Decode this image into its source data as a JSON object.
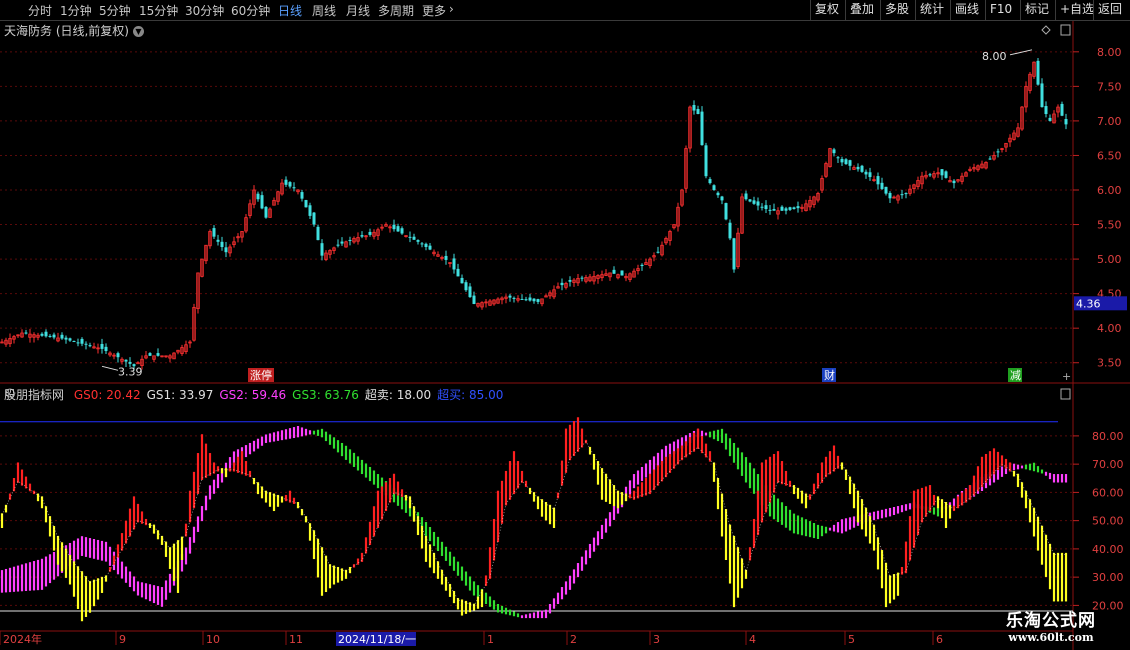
{
  "toolbar": {
    "periods": [
      "分时",
      "1分钟",
      "5分钟",
      "15分钟",
      "30分钟",
      "60分钟",
      "日线",
      "周线",
      "月线",
      "多周期",
      "更多"
    ],
    "active_period": "日线",
    "right_buttons": [
      "复权",
      "叠加",
      "多股",
      "统计",
      "画线",
      "F10",
      "标记",
      "+自选",
      "返回"
    ]
  },
  "stock": {
    "title": "天海防务 (日线,前复权)"
  },
  "indicator": {
    "name": "股朋指标网",
    "labels": [
      {
        "text": "GS0: 20.42",
        "color": "#ff3030"
      },
      {
        "text": "GS1: 33.97",
        "color": "#e0e0e0"
      },
      {
        "text": "GS2: 59.46",
        "color": "#ff40ff"
      },
      {
        "text": "GS3: 63.76",
        "color": "#30e030"
      },
      {
        "text": "超卖: 18.00",
        "color": "#e0e0e0"
      },
      {
        "text": "超买: 85.00",
        "color": "#3050ff"
      }
    ]
  },
  "price_axis": {
    "ticks": [
      "8.00",
      "7.50",
      "7.00",
      "6.50",
      "6.00",
      "5.50",
      "5.00",
      "4.50",
      "4.00",
      "3.50"
    ],
    "current": "4.36"
  },
  "ind_axis": {
    "ticks": [
      "80.00",
      "70.00",
      "60.00",
      "50.00",
      "40.00",
      "30.00",
      "20.00"
    ]
  },
  "markers": {
    "high": "8.00",
    "low": "3.39",
    "events": [
      "涨停",
      "财",
      "减"
    ]
  },
  "x_axis": {
    "labels": [
      "2024年",
      "9",
      "10",
      "11",
      "2024/11/18/一",
      "1",
      "2",
      "3",
      "4",
      "5",
      "6"
    ]
  },
  "watermark": {
    "line1": "乐淘公式网",
    "line2": "www.60lt.com"
  },
  "chart_data": {
    "type": "candlestick",
    "price_ylim": [
      3.25,
      8.2
    ],
    "indicator_ylim": [
      12,
      92
    ],
    "overbought": 85,
    "oversold": 18,
    "close_keypoints": [
      [
        0,
        3.8
      ],
      [
        5,
        3.93
      ],
      [
        15,
        3.85
      ],
      [
        25,
        3.7
      ],
      [
        30,
        3.55
      ],
      [
        33,
        3.45
      ],
      [
        36,
        3.6
      ],
      [
        42,
        3.6
      ],
      [
        47,
        3.8
      ],
      [
        49,
        4.8
      ],
      [
        52,
        5.4
      ],
      [
        56,
        5.1
      ],
      [
        60,
        5.4
      ],
      [
        63,
        6.0
      ],
      [
        66,
        5.6
      ],
      [
        70,
        6.1
      ],
      [
        74,
        6.0
      ],
      [
        78,
        5.5
      ],
      [
        80,
        5.05
      ],
      [
        84,
        5.2
      ],
      [
        88,
        5.3
      ],
      [
        92,
        5.35
      ],
      [
        96,
        5.5
      ],
      [
        99,
        5.4
      ],
      [
        104,
        5.25
      ],
      [
        108,
        5.1
      ],
      [
        112,
        4.95
      ],
      [
        118,
        4.35
      ],
      [
        121,
        4.38
      ],
      [
        126,
        4.45
      ],
      [
        130,
        4.42
      ],
      [
        134,
        4.38
      ],
      [
        139,
        4.6
      ],
      [
        144,
        4.72
      ],
      [
        148,
        4.75
      ],
      [
        152,
        4.8
      ],
      [
        156,
        4.75
      ],
      [
        160,
        4.9
      ],
      [
        164,
        5.1
      ],
      [
        168,
        5.5
      ],
      [
        170,
        6.0
      ],
      [
        172,
        7.2
      ],
      [
        174,
        7.1
      ],
      [
        176,
        6.2
      ],
      [
        178,
        6.0
      ],
      [
        180,
        5.85
      ],
      [
        182,
        5.3
      ],
      [
        183,
        4.85
      ],
      [
        185,
        5.9
      ],
      [
        188,
        5.8
      ],
      [
        192,
        5.7
      ],
      [
        196,
        5.7
      ],
      [
        200,
        5.75
      ],
      [
        204,
        5.95
      ],
      [
        207,
        6.6
      ],
      [
        210,
        6.4
      ],
      [
        214,
        6.3
      ],
      [
        218,
        6.15
      ],
      [
        222,
        5.88
      ],
      [
        226,
        5.95
      ],
      [
        230,
        6.2
      ],
      [
        234,
        6.25
      ],
      [
        238,
        6.1
      ],
      [
        242,
        6.3
      ],
      [
        246,
        6.4
      ],
      [
        250,
        6.6
      ],
      [
        254,
        6.9
      ],
      [
        256,
        7.5
      ],
      [
        258,
        7.85
      ],
      [
        260,
        7.2
      ],
      [
        262,
        7.0
      ],
      [
        264,
        7.2
      ],
      [
        266,
        6.95
      ]
    ],
    "gs0_keypoints": [
      [
        0,
        48
      ],
      [
        4,
        70
      ],
      [
        10,
        55
      ],
      [
        14,
        35
      ],
      [
        17,
        28
      ],
      [
        20,
        15
      ],
      [
        22,
        18
      ],
      [
        25,
        25
      ],
      [
        30,
        45
      ],
      [
        33,
        58
      ],
      [
        36,
        50
      ],
      [
        40,
        42
      ],
      [
        44,
        25
      ],
      [
        47,
        60
      ],
      [
        50,
        80
      ],
      [
        53,
        70
      ],
      [
        56,
        66
      ],
      [
        60,
        74
      ],
      [
        64,
        60
      ],
      [
        68,
        54
      ],
      [
        72,
        60
      ],
      [
        76,
        50
      ],
      [
        80,
        24
      ],
      [
        83,
        28
      ],
      [
        86,
        30
      ],
      [
        90,
        38
      ],
      [
        94,
        60
      ],
      [
        98,
        66
      ],
      [
        102,
        55
      ],
      [
        106,
        36
      ],
      [
        110,
        28
      ],
      [
        115,
        17
      ],
      [
        120,
        20
      ],
      [
        124,
        60
      ],
      [
        128,
        74
      ],
      [
        132,
        60
      ],
      [
        135,
        52
      ],
      [
        138,
        48
      ],
      [
        141,
        82
      ],
      [
        144,
        86
      ],
      [
        147,
        74
      ],
      [
        150,
        58
      ],
      [
        154,
        55
      ],
      [
        158,
        60
      ],
      [
        162,
        66
      ],
      [
        166,
        72
      ],
      [
        170,
        76
      ],
      [
        174,
        82
      ],
      [
        177,
        74
      ],
      [
        180,
        45
      ],
      [
        183,
        20
      ],
      [
        186,
        30
      ],
      [
        190,
        70
      ],
      [
        194,
        74
      ],
      [
        198,
        60
      ],
      [
        201,
        55
      ],
      [
        205,
        70
      ],
      [
        208,
        76
      ],
      [
        211,
        65
      ],
      [
        214,
        50
      ],
      [
        218,
        40
      ],
      [
        221,
        20
      ],
      [
        224,
        24
      ],
      [
        228,
        60
      ],
      [
        232,
        62
      ],
      [
        236,
        48
      ],
      [
        239,
        58
      ],
      [
        242,
        62
      ],
      [
        245,
        72
      ],
      [
        248,
        75
      ],
      [
        252,
        70
      ],
      [
        256,
        55
      ],
      [
        260,
        35
      ],
      [
        263,
        22
      ]
    ],
    "gs1_keypoints": [
      [
        0,
        52
      ],
      [
        4,
        64
      ],
      [
        10,
        58
      ],
      [
        14,
        44
      ],
      [
        18,
        35
      ],
      [
        22,
        28
      ],
      [
        26,
        30
      ],
      [
        30,
        40
      ],
      [
        34,
        50
      ],
      [
        38,
        48
      ],
      [
        42,
        40
      ],
      [
        46,
        45
      ],
      [
        50,
        65
      ],
      [
        54,
        68
      ],
      [
        58,
        68
      ],
      [
        62,
        66
      ],
      [
        66,
        60
      ],
      [
        70,
        58
      ],
      [
        74,
        56
      ],
      [
        78,
        46
      ],
      [
        82,
        34
      ],
      [
        86,
        32
      ],
      [
        90,
        36
      ],
      [
        94,
        48
      ],
      [
        98,
        60
      ],
      [
        102,
        58
      ],
      [
        106,
        44
      ],
      [
        110,
        32
      ],
      [
        114,
        22
      ],
      [
        118,
        20
      ],
      [
        122,
        30
      ],
      [
        126,
        56
      ],
      [
        130,
        64
      ],
      [
        134,
        58
      ],
      [
        138,
        54
      ],
      [
        142,
        72
      ],
      [
        146,
        78
      ],
      [
        150,
        68
      ],
      [
        154,
        60
      ],
      [
        158,
        58
      ],
      [
        162,
        60
      ],
      [
        166,
        66
      ],
      [
        170,
        72
      ],
      [
        174,
        76
      ],
      [
        178,
        70
      ],
      [
        182,
        48
      ],
      [
        186,
        32
      ],
      [
        190,
        50
      ],
      [
        194,
        64
      ],
      [
        198,
        62
      ],
      [
        202,
        58
      ],
      [
        206,
        66
      ],
      [
        210,
        70
      ],
      [
        214,
        60
      ],
      [
        218,
        48
      ],
      [
        222,
        30
      ],
      [
        226,
        32
      ],
      [
        230,
        50
      ],
      [
        234,
        58
      ],
      [
        238,
        54
      ],
      [
        242,
        58
      ],
      [
        246,
        64
      ],
      [
        250,
        70
      ],
      [
        254,
        66
      ],
      [
        258,
        54
      ],
      [
        263,
        38
      ]
    ],
    "gs2_keypoints": [
      [
        0,
        32
      ],
      [
        10,
        36
      ],
      [
        20,
        44
      ],
      [
        26,
        42
      ],
      [
        34,
        28
      ],
      [
        40,
        26
      ],
      [
        46,
        40
      ],
      [
        52,
        62
      ],
      [
        58,
        74
      ],
      [
        66,
        80
      ],
      [
        74,
        83
      ],
      [
        80,
        80
      ],
      [
        86,
        72
      ],
      [
        94,
        62
      ],
      [
        102,
        52
      ],
      [
        110,
        38
      ],
      [
        118,
        24
      ],
      [
        124,
        18
      ],
      [
        130,
        16
      ],
      [
        136,
        18
      ],
      [
        142,
        30
      ],
      [
        150,
        48
      ],
      [
        158,
        66
      ],
      [
        166,
        76
      ],
      [
        174,
        82
      ],
      [
        180,
        78
      ],
      [
        186,
        64
      ],
      [
        192,
        52
      ],
      [
        198,
        46
      ],
      [
        204,
        44
      ],
      [
        210,
        50
      ],
      [
        216,
        52
      ],
      [
        222,
        54
      ],
      [
        228,
        56
      ],
      [
        234,
        52
      ],
      [
        240,
        60
      ],
      [
        246,
        66
      ],
      [
        252,
        70
      ],
      [
        258,
        68
      ],
      [
        263,
        66
      ]
    ],
    "gs3_keypoints": [
      [
        0,
        25
      ],
      [
        10,
        26
      ],
      [
        20,
        38
      ],
      [
        26,
        36
      ],
      [
        34,
        24
      ],
      [
        40,
        20
      ],
      [
        46,
        35
      ],
      [
        52,
        58
      ],
      [
        58,
        70
      ],
      [
        66,
        78
      ],
      [
        74,
        80
      ],
      [
        80,
        82
      ],
      [
        86,
        76
      ],
      [
        94,
        66
      ],
      [
        102,
        56
      ],
      [
        110,
        42
      ],
      [
        118,
        28
      ],
      [
        124,
        20
      ],
      [
        130,
        16
      ],
      [
        136,
        16
      ],
      [
        142,
        26
      ],
      [
        150,
        44
      ],
      [
        158,
        62
      ],
      [
        166,
        72
      ],
      [
        174,
        80
      ],
      [
        180,
        82
      ],
      [
        186,
        72
      ],
      [
        192,
        60
      ],
      [
        198,
        52
      ],
      [
        204,
        48
      ],
      [
        210,
        46
      ],
      [
        216,
        50
      ],
      [
        222,
        52
      ],
      [
        228,
        55
      ],
      [
        234,
        54
      ],
      [
        240,
        56
      ],
      [
        246,
        62
      ],
      [
        252,
        68
      ],
      [
        258,
        70
      ],
      [
        263,
        64
      ]
    ]
  }
}
